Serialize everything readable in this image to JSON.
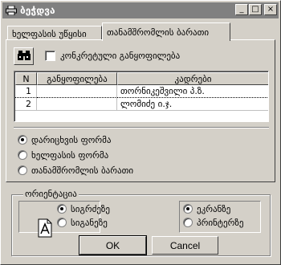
{
  "window": {
    "title": "ბეჭდვა",
    "buttons": {
      "minimize": "_",
      "maximize": "□",
      "close": "×"
    }
  },
  "tabs": [
    {
      "label": "ხელფასის უწყისი",
      "active": false
    },
    {
      "label": "თანამშრომლის ბარათი",
      "active": true
    }
  ],
  "toolbar": {
    "search_icon": "binoculars-icon",
    "specific_option_label": "კონკრეტული განყოფილება",
    "specific_option_checked": false
  },
  "grid": {
    "columns": [
      "N",
      "განყოფილება",
      "კადრები"
    ],
    "rows": [
      {
        "n": "1",
        "department": "",
        "employee": "თორნიკეშვილი პ.ზ.",
        "selected": true
      },
      {
        "n": "2",
        "department": "",
        "employee": "ლომიძე ი.ჯ.",
        "selected": false
      }
    ]
  },
  "report_type": {
    "options": [
      "დარიცხვის ფორმა",
      "ხელფასის ფორმა",
      "თანამშრომლის ბარათი"
    ],
    "selected_index": 0
  },
  "orientation": {
    "legend": "ორიენტაცია",
    "options": [
      "სიგრძეზე",
      "სიგანეზე"
    ],
    "selected_index": 0,
    "icon": "page-orientation-icon"
  },
  "pages": {
    "options": [
      "ეკრანზე",
      "პრინტერზე"
    ],
    "selected_index": 0
  },
  "actions": {
    "ok_label": "OK",
    "cancel_label": "Cancel"
  }
}
